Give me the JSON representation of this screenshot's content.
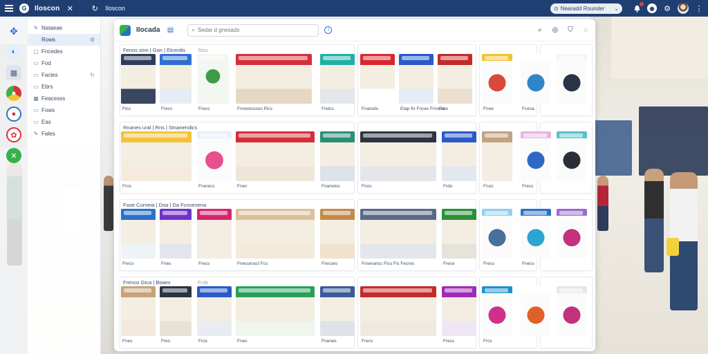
{
  "topbar": {
    "app_title": "Iloscon",
    "search_text": "Nearadd Rounder",
    "logo_glyph": "G"
  },
  "nav": {
    "items": [
      {
        "label": "Nataeae",
        "active": false
      },
      {
        "label": "Rows",
        "active": true
      },
      {
        "label": "Fncedes",
        "active": false
      },
      {
        "label": "Fod",
        "active": false
      },
      {
        "label": "Facies",
        "active": false
      },
      {
        "label": "Ebrs",
        "active": false
      },
      {
        "label": "Feacesss",
        "active": false
      },
      {
        "label": "Fows",
        "active": false
      },
      {
        "label": "Eas",
        "active": false
      },
      {
        "label": "Fales",
        "active": false
      }
    ]
  },
  "window": {
    "title": "IIocada",
    "search_placeholder": "Sedar d gnesads"
  },
  "rows": [
    {
      "panel1_title": "Fenos sinn | Gon | Etcerdis",
      "panel1_sub": "Stos",
      "captions": [
        "Ftcs",
        "Frecs",
        "Frecs",
        "Fncerescces Pics",
        "Frelcs",
        "Fnanslis",
        "Etap fix Fnces Fnnesa",
        "Frce",
        "Fnoe",
        "Fcesa"
      ]
    },
    {
      "panel1_title": "Rnanes ural | Rns | Stnanendics",
      "captions": [
        "Fros",
        "Fnerecs",
        "Fnec",
        "Fnanolos",
        "Fnos",
        "Frdo",
        "Fnos",
        "Frecs"
      ]
    },
    {
      "panel1_title": "Fooe Curneia | Doa | Da Fcnsenena",
      "captions": [
        "Frecs",
        "Fnes",
        "Frecs",
        "Fnecuroscl Fcs",
        "Frecses",
        "Fnserancc Fics Fis Fecres",
        "Frece",
        "Frecs",
        "Fnecs"
      ]
    },
    {
      "panel1_title": "Frenco Gtca | Boaes",
      "panel1_sub": "Frde",
      "captions": [
        "Fnes",
        "Fres",
        "Fros",
        "Fnes",
        "Fnenes",
        "Frecs",
        "Frecs",
        "Frcs"
      ]
    }
  ],
  "colors": {
    "topbar": "#1f3f73",
    "accent_blue": "#2a72c8",
    "accent_green": "#37b14a",
    "accent_red": "#d7333a",
    "accent_pink": "#d9358a"
  }
}
